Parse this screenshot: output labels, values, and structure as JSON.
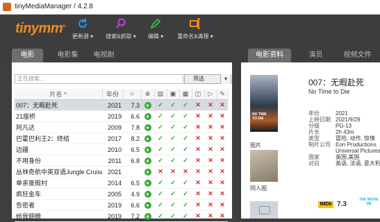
{
  "window": {
    "title": "tinyMediaManager / 4.2.8"
  },
  "toolbar": {
    "logo": "tinymm",
    "buttons": [
      {
        "label": "更新源 ▾",
        "icon": "refresh-icon"
      },
      {
        "label": "搜索&抓取 ▾",
        "icon": "search-icon"
      },
      {
        "label": "编辑 ▾",
        "icon": "pencil-icon"
      },
      {
        "label": "重命名&清理 ▾",
        "icon": "rename-icon"
      }
    ]
  },
  "left_tabs": [
    "电影",
    "电影集",
    "电视剧"
  ],
  "search": {
    "placeholder": "正在搜索..."
  },
  "filter": {
    "label": "筛选"
  },
  "table": {
    "columns": {
      "title": "片名",
      "year": "年份"
    },
    "rows": [
      {
        "title": "007：无暇赴死",
        "year": "2021",
        "rating": "7.3",
        "marks": [
          "ok",
          "ok",
          "ok",
          "no",
          "no",
          "no"
        ],
        "selected": true
      },
      {
        "title": "21座桥",
        "year": "2019",
        "rating": "6.6",
        "marks": [
          "ok",
          "ok",
          "ok",
          "no",
          "no",
          "no"
        ],
        "selected": false
      },
      {
        "title": "阿凡达",
        "year": "2009",
        "rating": "7.8",
        "marks": [
          "ok",
          "ok",
          "ok",
          "no",
          "no",
          "no"
        ],
        "selected": false
      },
      {
        "title": "巴霍巴利王2：终结",
        "year": "2017",
        "rating": "8.2",
        "marks": [
          "ok",
          "ok",
          "ok",
          "no",
          "no",
          "no"
        ],
        "selected": false
      },
      {
        "title": "边疆",
        "year": "2010",
        "rating": "6.5",
        "marks": [
          "ok",
          "ok",
          "ok",
          "no",
          "no",
          "no"
        ],
        "selected": false
      },
      {
        "title": "不用身份",
        "year": "2011",
        "rating": "6.8",
        "marks": [
          "ok",
          "ok",
          "ok",
          "no",
          "no",
          "no"
        ],
        "selected": false
      },
      {
        "title": "丛林奇航中英双语Jungle Cruise",
        "year": "2021",
        "rating": "",
        "marks": [
          "no",
          "no",
          "no",
          "no",
          "no",
          "no"
        ],
        "selected": false
      },
      {
        "title": "单亲度假村",
        "year": "2014",
        "rating": "6.5",
        "marks": [
          "ok",
          "ok",
          "ok",
          "no",
          "no",
          "no"
        ],
        "selected": false
      },
      {
        "title": "疯狂金车",
        "year": "2005",
        "rating": "4.9",
        "marks": [
          "ok",
          "ok",
          "ok",
          "no",
          "no",
          "no"
        ],
        "selected": false
      },
      {
        "title": "告密者",
        "year": "2019",
        "rating": "6.6",
        "marks": [
          "ok",
          "ok",
          "ok",
          "no",
          "no",
          "no"
        ],
        "selected": false
      },
      {
        "title": "给我翅膀",
        "year": "2019",
        "rating": "7.2",
        "marks": [
          "ok",
          "ok",
          "ok",
          "no",
          "no",
          "no"
        ],
        "selected": false
      }
    ]
  },
  "right_tabs": [
    "电影资料",
    "演员",
    "视频文件"
  ],
  "details": {
    "poster_caption": "图片",
    "fanart_caption": "同人图",
    "title": "007：无暇赴死",
    "original_title": "No Time to Die",
    "rows": [
      {
        "k": "年份",
        "v": "2021"
      },
      {
        "k": "上映日期",
        "v": "2021/9/29"
      },
      {
        "k": "分级",
        "v": "PG-13"
      },
      {
        "k": "片长",
        "v": "2h 43m"
      },
      {
        "k": "类型",
        "v": "冒险, 动作, 惊悚"
      },
      {
        "k": "制片公司",
        "v": "Eon Productions"
      },
      {
        "k": "",
        "v": "Universal Pictures"
      },
      {
        "k": "国家",
        "v": "英国,美国"
      },
      {
        "k": "对白",
        "v": "英语, 法语, 意大利"
      }
    ],
    "imdb_badge": "IMDb",
    "rating": "7.3",
    "tmdb_badge": "THE MOVIE DB"
  },
  "colors": {
    "accent": "#f08a24",
    "ok": "#2aa52a",
    "no": "#d42a2a",
    "add": "#3ca63c"
  }
}
